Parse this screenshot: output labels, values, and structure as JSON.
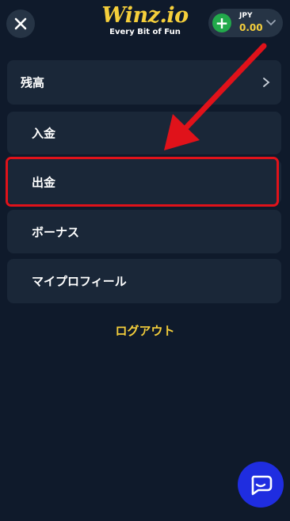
{
  "header": {
    "logo_title": "Winz.io",
    "logo_tagline": "Every Bit of Fun",
    "wallet": {
      "currency": "JPY",
      "amount": "0.00"
    },
    "icons": [
      "close-icon",
      "plus-icon",
      "chevron-down-icon"
    ]
  },
  "menu": {
    "balance": "残高",
    "deposit": "入金",
    "withdraw": "出金",
    "bonus": "ボーナス",
    "profile": "マイプロフィール",
    "logout": "ログアウト"
  },
  "colors": {
    "background": "#0f1a2b",
    "card": "#1a2738",
    "accent_yellow": "#f5cf3b",
    "plus_green": "#22a94b",
    "annotation_red": "#e0121a",
    "chat_blue": "#1f2de0"
  },
  "annotation": {
    "highlighted_item": "withdraw"
  },
  "chat": {
    "icon": "chat-icon"
  }
}
